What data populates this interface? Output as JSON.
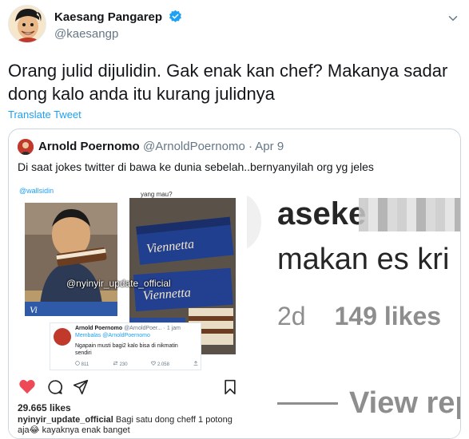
{
  "tweet": {
    "author_name": "Kaesang Pangarep",
    "author_handle": "@kaesangp",
    "text": "Orang julid dijulidin. Gak enak kan chef? Makanya sadar dong kalo anda itu kurang julidnya",
    "translate_label": "Translate Tweet"
  },
  "quoted_tweet": {
    "author_name": "Arnold Poernomo",
    "author_handle": "@ArnoldPoernomo",
    "date": "· Apr 9",
    "text": "Di saat jokes twitter di bawa ke dunia sebelah..bernyanyilah org yg jeles"
  },
  "media": {
    "meme": {
      "top_handle": "@wallsidin",
      "caption_top": "yang mau?",
      "watermark": "@nyinyir_update_official",
      "embedded_tweet": {
        "name": "Arnold Poernomo",
        "handle_time": "@ArnoldPoer... · 1 jam",
        "reply_to": "Membalas @ArnoldPoernomo",
        "text": "Ngapain musti bagi2 kalo bisa di nikmatin sendiri",
        "replies": "811",
        "retweets": "230",
        "likes": "2.058"
      }
    },
    "instagram_post": {
      "likes": "29.665 likes",
      "caption_user": "nyinyir_update_official",
      "caption_text": "Bagi satu dong cheff 1 potong aja😂 kayaknya enak banget"
    },
    "comment_zoom": {
      "line1": "aseke",
      "line2": "makan es kri",
      "time": "2d",
      "likes": "149 likes",
      "view_replies": "View rep"
    }
  },
  "colors": {
    "link_blue": "#1da1f2",
    "verified_blue": "#1da1f2",
    "heart_red": "#ed4956",
    "muted_gray": "#657786"
  }
}
